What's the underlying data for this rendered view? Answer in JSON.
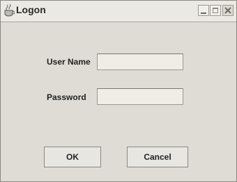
{
  "window": {
    "title": "Logon",
    "app_icon": "cup-icon"
  },
  "titlebar_buttons": {
    "minimize_icon": "minimize-icon",
    "maximize_icon": "maximize-icon",
    "close_icon": "close-icon"
  },
  "form": {
    "username_label": "User Name",
    "username_value": "",
    "password_label": "Password",
    "password_value": ""
  },
  "buttons": {
    "ok_label": "OK",
    "cancel_label": "Cancel"
  },
  "colors": {
    "background": "#dedcd5",
    "field_background": "#f0ede6"
  }
}
